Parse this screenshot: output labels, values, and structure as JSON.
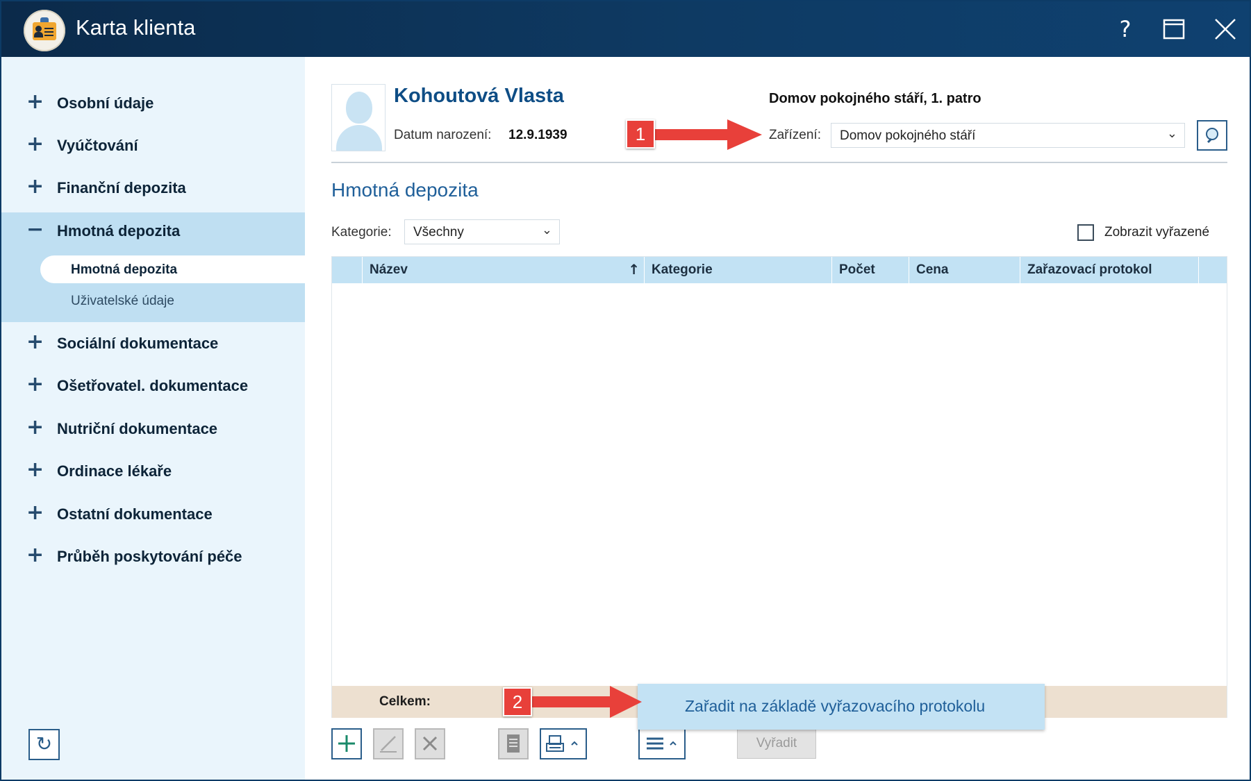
{
  "window": {
    "title": "Karta klienta",
    "help_glyph": "?",
    "maximize_glyph": "☐",
    "close_glyph": "✕"
  },
  "sidebar": {
    "items": [
      {
        "label": "Osobní údaje",
        "expanded": false
      },
      {
        "label": "Vyúčtování",
        "expanded": false
      },
      {
        "label": "Finanční depozita",
        "expanded": false
      },
      {
        "label": "Hmotná depozita",
        "expanded": true,
        "children": [
          {
            "label": "Hmotná depozita",
            "active": true
          },
          {
            "label": "Uživatelské údaje",
            "active": false
          }
        ]
      },
      {
        "label": "Sociální dokumentace",
        "expanded": false
      },
      {
        "label": "Ošetřovatel. dokumentace",
        "expanded": false
      },
      {
        "label": "Nutriční dokumentace",
        "expanded": false
      },
      {
        "label": "Ordinace lékaře",
        "expanded": false
      },
      {
        "label": "Ostatní dokumentace",
        "expanded": false
      },
      {
        "label": "Průběh poskytování péče",
        "expanded": false
      }
    ],
    "plus_glyph": "+",
    "minus_glyph": "−",
    "refresh_glyph": "↻"
  },
  "client": {
    "name": "Kohoutová Vlasta",
    "dob_label": "Datum narození:",
    "dob_value": "12.9.1939",
    "facility_title": "Domov pokojného stáří, 1. patro",
    "facility_label": "Zařízení:",
    "facility_value": "Domov pokojného stáří"
  },
  "section": {
    "title": "Hmotná depozita",
    "category_label": "Kategorie:",
    "category_value": "Všechny",
    "show_discarded_label": "Zobrazit vyřazené",
    "show_discarded_checked": false
  },
  "table": {
    "columns": [
      "Název",
      "Kategorie",
      "Počet",
      "Cena",
      "Zařazovací protokol"
    ],
    "sort_glyph": "↑",
    "rows": [],
    "total_label": "Celkem:"
  },
  "toolbar": {
    "add_glyph": "+",
    "edit_glyph": "∕",
    "delete_glyph": "✕",
    "discard_label": "Vyřadit"
  },
  "popup": {
    "label": "Zařadit na základě vyřazovacího protokolu"
  },
  "annotations": {
    "marker1": "1",
    "marker2": "2",
    "color": "#e8403a"
  },
  "colors": {
    "titlebar": "#0e3a63",
    "sidebar_bg": "#eaf5fc",
    "sidebar_open": "#bfdff2",
    "accent": "#1f5f99",
    "grid_header": "#c2e2f4",
    "total_row": "#ede0d0"
  }
}
